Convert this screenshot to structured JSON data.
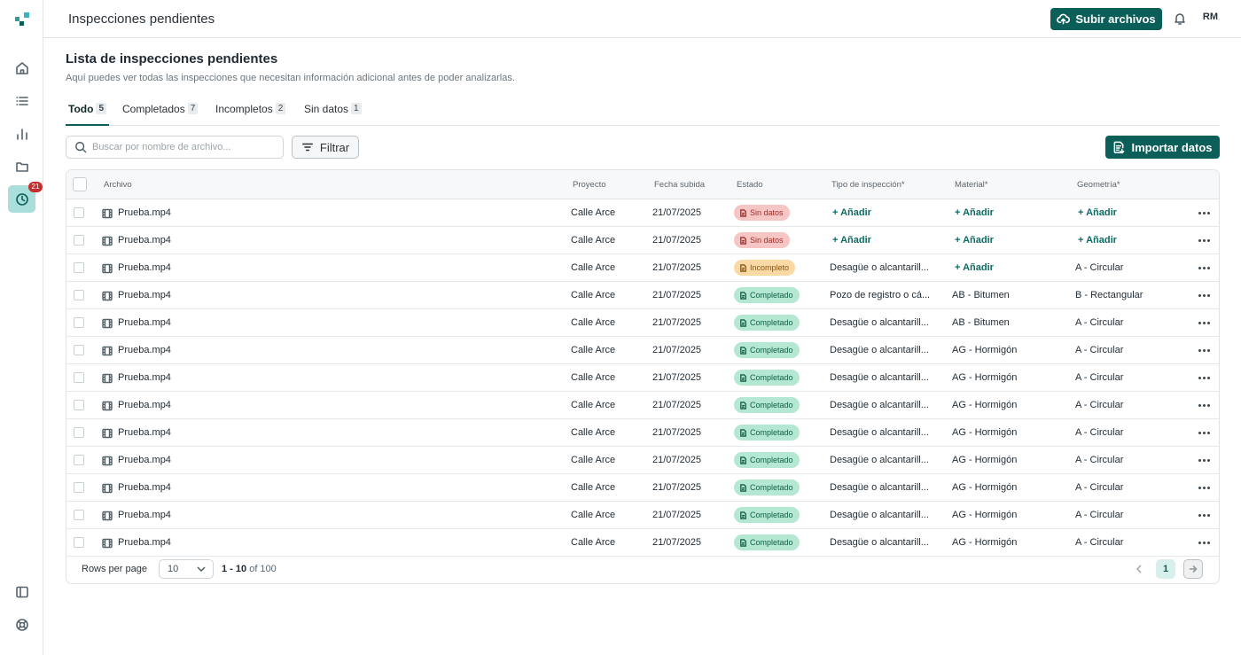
{
  "sidebar": {
    "badge_count": "21",
    "accent_color": "#a9dedb",
    "items": [
      "home-icon",
      "list-icon",
      "chart-icon",
      "folder-icon",
      "clock-icon"
    ],
    "bottom_items": [
      "panel-icon",
      "help-icon"
    ]
  },
  "header": {
    "title": "Inspecciones pendientes",
    "upload_label": "Subir archivos",
    "avatar_initials": "RM",
    "brand_color": "#0c5f58"
  },
  "main": {
    "title": "Lista de inspecciones pendientes",
    "subtitle": "Aquí puedes ver todas las inspecciones que necesitan información adicional antes de poder analizarlas.",
    "tabs": [
      {
        "label": "Todo",
        "count": "5"
      },
      {
        "label": "Completados",
        "count": "7"
      },
      {
        "label": "Incompletos",
        "count": "2"
      },
      {
        "label": "Sin datos",
        "count": "1"
      }
    ],
    "search_placeholder": "Buscar por nombre de archivo...",
    "filter_label": "Filtrar",
    "import_label": "Importar datos"
  },
  "table": {
    "headers": {
      "file": "Archivo",
      "project": "Proyecto",
      "date": "Fecha subida",
      "status": "Estado",
      "type": "Tipo de inspección*",
      "material": "Material*",
      "geometry": "Geometría*"
    },
    "rows": [
      {
        "file": "Prueba.mp4",
        "project": "Calle Arce",
        "date": "21/07/2025",
        "status": "Sin datos",
        "status_kind": "sin",
        "type": "+ Añadir",
        "material": "+ Añadir",
        "geometry": "+ Añadir"
      },
      {
        "file": "Prueba.mp4",
        "project": "Calle Arce",
        "date": "21/07/2025",
        "status": "Sin datos",
        "status_kind": "sin",
        "type": "+ Añadir",
        "material": "+ Añadir",
        "geometry": "+ Añadir"
      },
      {
        "file": "Prueba.mp4",
        "project": "Calle Arce",
        "date": "21/07/2025",
        "status": "Incompleto",
        "status_kind": "inc",
        "type": "Desagüe o alcantarill...",
        "material": "+ Añadir",
        "geometry": "A - Circular"
      },
      {
        "file": "Prueba.mp4",
        "project": "Calle Arce",
        "date": "21/07/2025",
        "status": "Completado",
        "status_kind": "comp",
        "type": "Pozo de registro o cá...",
        "material": "AB - Bitumen",
        "geometry": "B - Rectangular"
      },
      {
        "file": "Prueba.mp4",
        "project": "Calle Arce",
        "date": "21/07/2025",
        "status": "Completado",
        "status_kind": "comp",
        "type": "Desagüe o alcantarill...",
        "material": "AB - Bitumen",
        "geometry": "A - Circular"
      },
      {
        "file": "Prueba.mp4",
        "project": "Calle Arce",
        "date": "21/07/2025",
        "status": "Completado",
        "status_kind": "comp",
        "type": "Desagüe o alcantarill...",
        "material": "AG - Hormigón",
        "geometry": "A - Circular"
      },
      {
        "file": "Prueba.mp4",
        "project": "Calle Arce",
        "date": "21/07/2025",
        "status": "Completado",
        "status_kind": "comp",
        "type": "Desagüe o alcantarill...",
        "material": "AG - Hormigón",
        "geometry": "A - Circular"
      },
      {
        "file": "Prueba.mp4",
        "project": "Calle Arce",
        "date": "21/07/2025",
        "status": "Completado",
        "status_kind": "comp",
        "type": "Desagüe o alcantarill...",
        "material": "AG - Hormigón",
        "geometry": "A - Circular"
      },
      {
        "file": "Prueba.mp4",
        "project": "Calle Arce",
        "date": "21/07/2025",
        "status": "Completado",
        "status_kind": "comp",
        "type": "Desagüe o alcantarill...",
        "material": "AG - Hormigón",
        "geometry": "A - Circular"
      },
      {
        "file": "Prueba.mp4",
        "project": "Calle Arce",
        "date": "21/07/2025",
        "status": "Completado",
        "status_kind": "comp",
        "type": "Desagüe o alcantarill...",
        "material": "AG - Hormigón",
        "geometry": "A - Circular"
      },
      {
        "file": "Prueba.mp4",
        "project": "Calle Arce",
        "date": "21/07/2025",
        "status": "Completado",
        "status_kind": "comp",
        "type": "Desagüe o alcantarill...",
        "material": "AG - Hormigón",
        "geometry": "A - Circular"
      },
      {
        "file": "Prueba.mp4",
        "project": "Calle Arce",
        "date": "21/07/2025",
        "status": "Completado",
        "status_kind": "comp",
        "type": "Desagüe o alcantarill...",
        "material": "AG - Hormigón",
        "geometry": "A - Circular"
      },
      {
        "file": "Prueba.mp4",
        "project": "Calle Arce",
        "date": "21/07/2025",
        "status": "Completado",
        "status_kind": "comp",
        "type": "Desagüe o alcantarill...",
        "material": "AG - Hormigón",
        "geometry": "A - Circular"
      }
    ]
  },
  "pagination": {
    "rows_per_page_label": "Rows per page",
    "rows_per_page": "10",
    "range": "1 - 10",
    "total": "of 100",
    "current_page": "1"
  }
}
